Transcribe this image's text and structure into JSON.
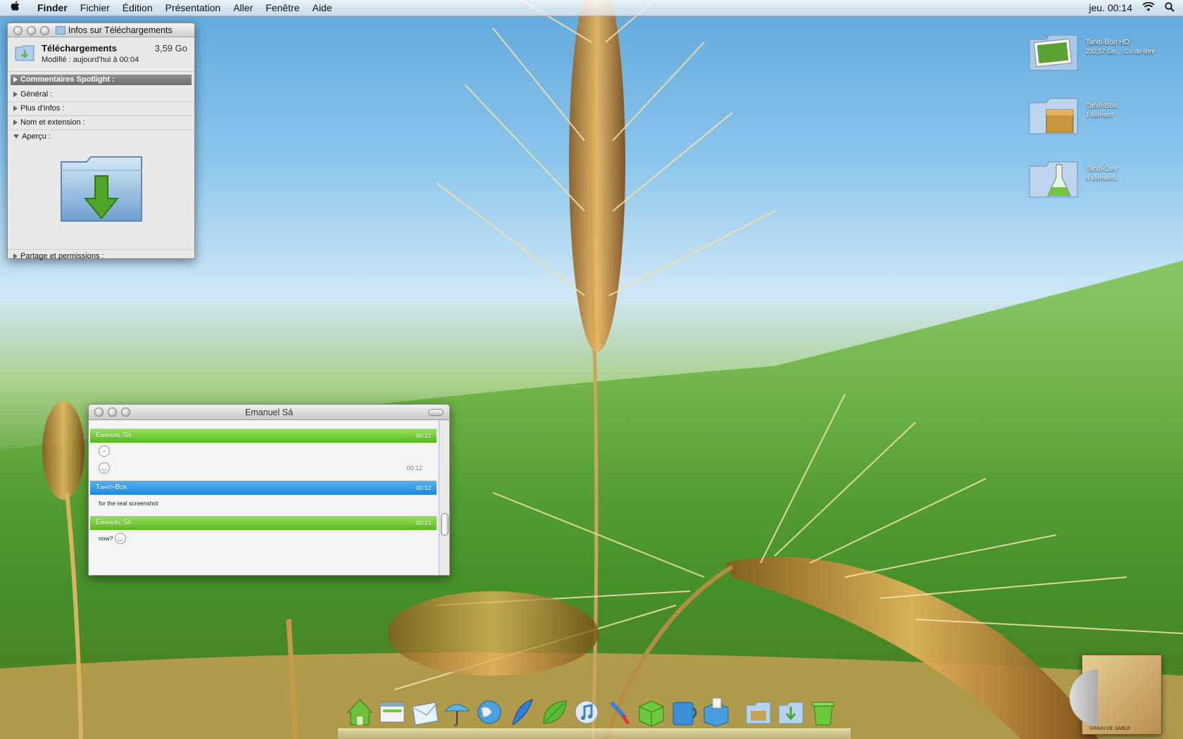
{
  "menubar": {
    "apple_icon": "apple-icon",
    "items": [
      "Finder",
      "Fichier",
      "Édition",
      "Présentation",
      "Aller",
      "Fenêtre",
      "Aide"
    ],
    "clock": "jeu. 00:14",
    "wifi_icon": "wifi-icon",
    "spotlight_icon": "spotlight-icon"
  },
  "info_window": {
    "title": "Infos sur Téléchargements",
    "name": "Téléchargements",
    "size": "3,59 Go",
    "modified": "Modifié : aujourd’hui à 00:04",
    "spotlight_header": "Commentaires Spotlight :",
    "sections": [
      "Général :",
      "Plus d’infos :",
      "Nom et extension :"
    ],
    "preview_label": "Aperçu :",
    "sharing": "Partage et permissions :"
  },
  "chat_window": {
    "title": "Emanuel Sá",
    "messages": [
      {
        "sender": "Emanuel Sá",
        "time": "00:12",
        "color": "#59b521"
      },
      {
        "sender": "Tahiti-Bob",
        "time": "00:12",
        "color": "#1a86de",
        "text": "for the real screenshot"
      },
      {
        "sender": "Emanuel Sá",
        "time": "00:13",
        "color": "#59b521",
        "text": "now?"
      }
    ],
    "inline_time": "00:12"
  },
  "desktop_icons": [
    {
      "name": "Tahiti-Bob HD",
      "detail": "232,57 Go, ...Go de libre"
    },
    {
      "name": "Tahiti-Box",
      "detail": "1 élément"
    },
    {
      "name": "Tahiti-Dev",
      "detail": "4 éléments"
    }
  ],
  "album": {
    "caption": "GRAIN DE SABLE"
  },
  "dock_icons": [
    "home-icon",
    "web-widget-icon",
    "mail-icon",
    "umbrella-icon",
    "globe-icon",
    "feather-icon",
    "leaf-icon",
    "itunes-icon",
    "paint-icon",
    "green-box-icon",
    "joost-icon",
    "blue-box-icon",
    "folder-icon",
    "downloads-folder-icon",
    "trash-icon"
  ]
}
